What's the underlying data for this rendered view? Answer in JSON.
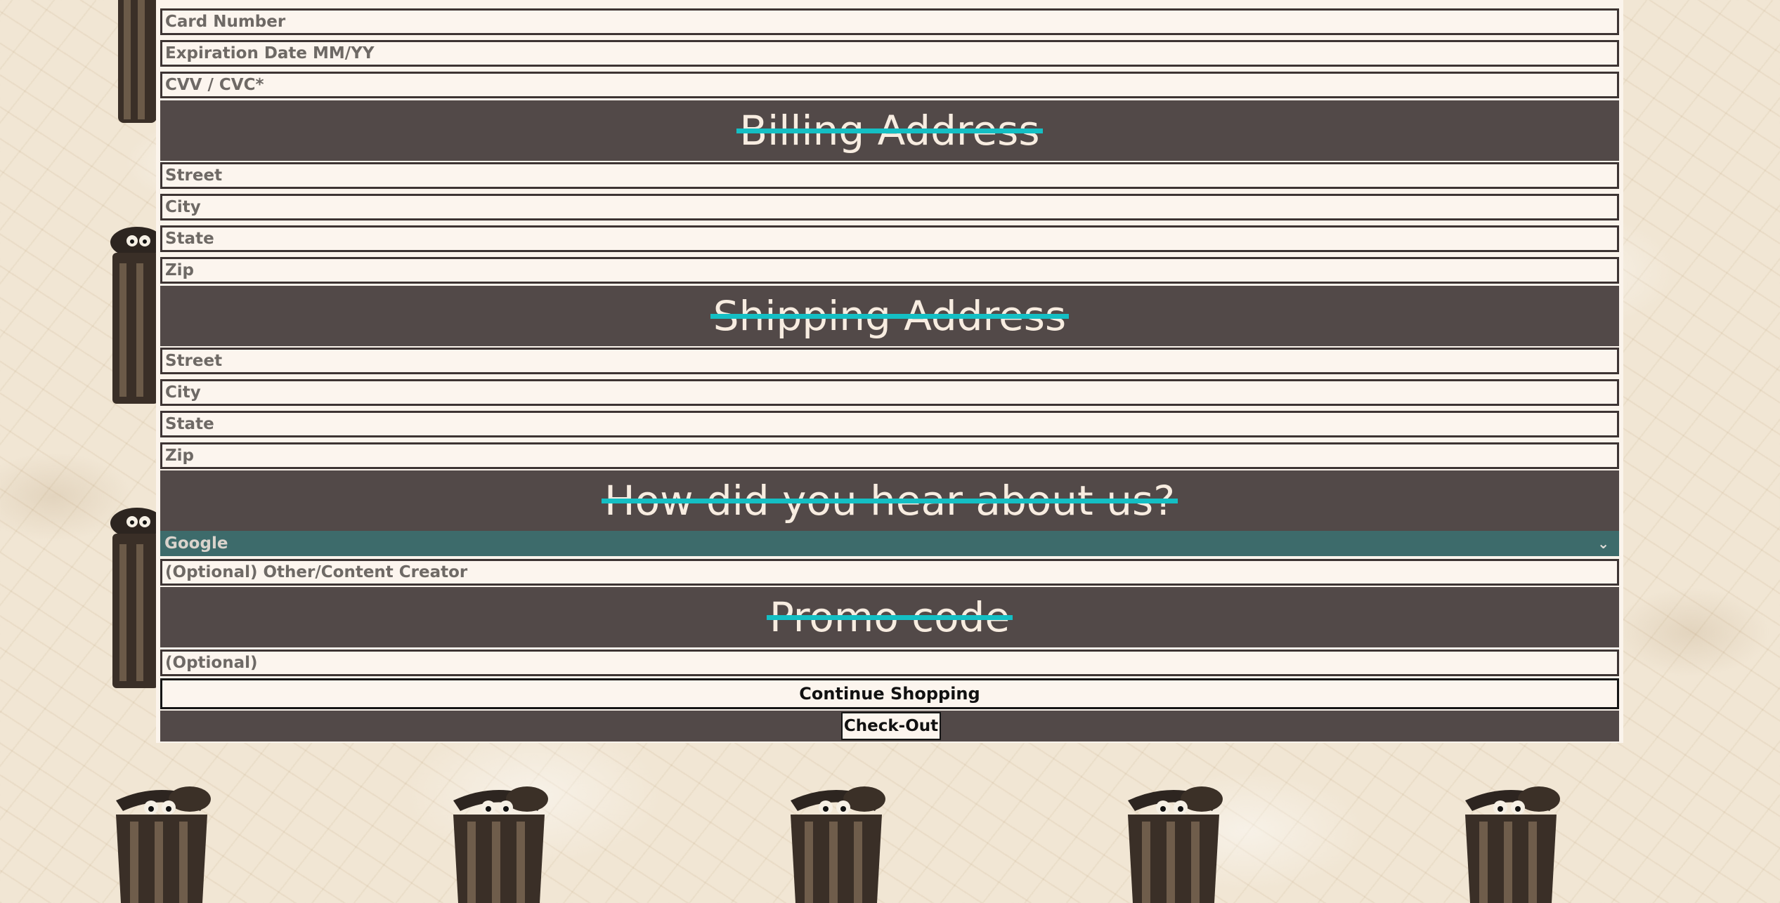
{
  "payment": {
    "card_number_placeholder": "Card Number",
    "expiration_placeholder": "Expiration Date MM/YY",
    "cvv_placeholder": "CVV / CVC*"
  },
  "billing": {
    "heading": "Billing Address",
    "street_placeholder": "Street",
    "city_placeholder": "City",
    "state_placeholder": "State",
    "zip_placeholder": "Zip"
  },
  "shipping": {
    "heading": "Shipping Address",
    "street_placeholder": "Street",
    "city_placeholder": "City",
    "state_placeholder": "State",
    "zip_placeholder": "Zip"
  },
  "referral": {
    "heading": "How did you hear about us?",
    "selected_option": "Google",
    "other_placeholder": "(Optional) Other/Content Creator"
  },
  "promo": {
    "heading": "Promo code",
    "placeholder": "(Optional)"
  },
  "actions": {
    "continue_label": "Continue Shopping",
    "checkout_label": "Check-Out"
  },
  "colors": {
    "section_header_bg": "#524948",
    "strikethrough": "#14bfc4",
    "select_bg": "#3d6b6b",
    "page_bg": "#efe3cf"
  },
  "icons": {
    "select_arrow": "chevron-down-icon",
    "decoration": "trash-can-icon"
  }
}
